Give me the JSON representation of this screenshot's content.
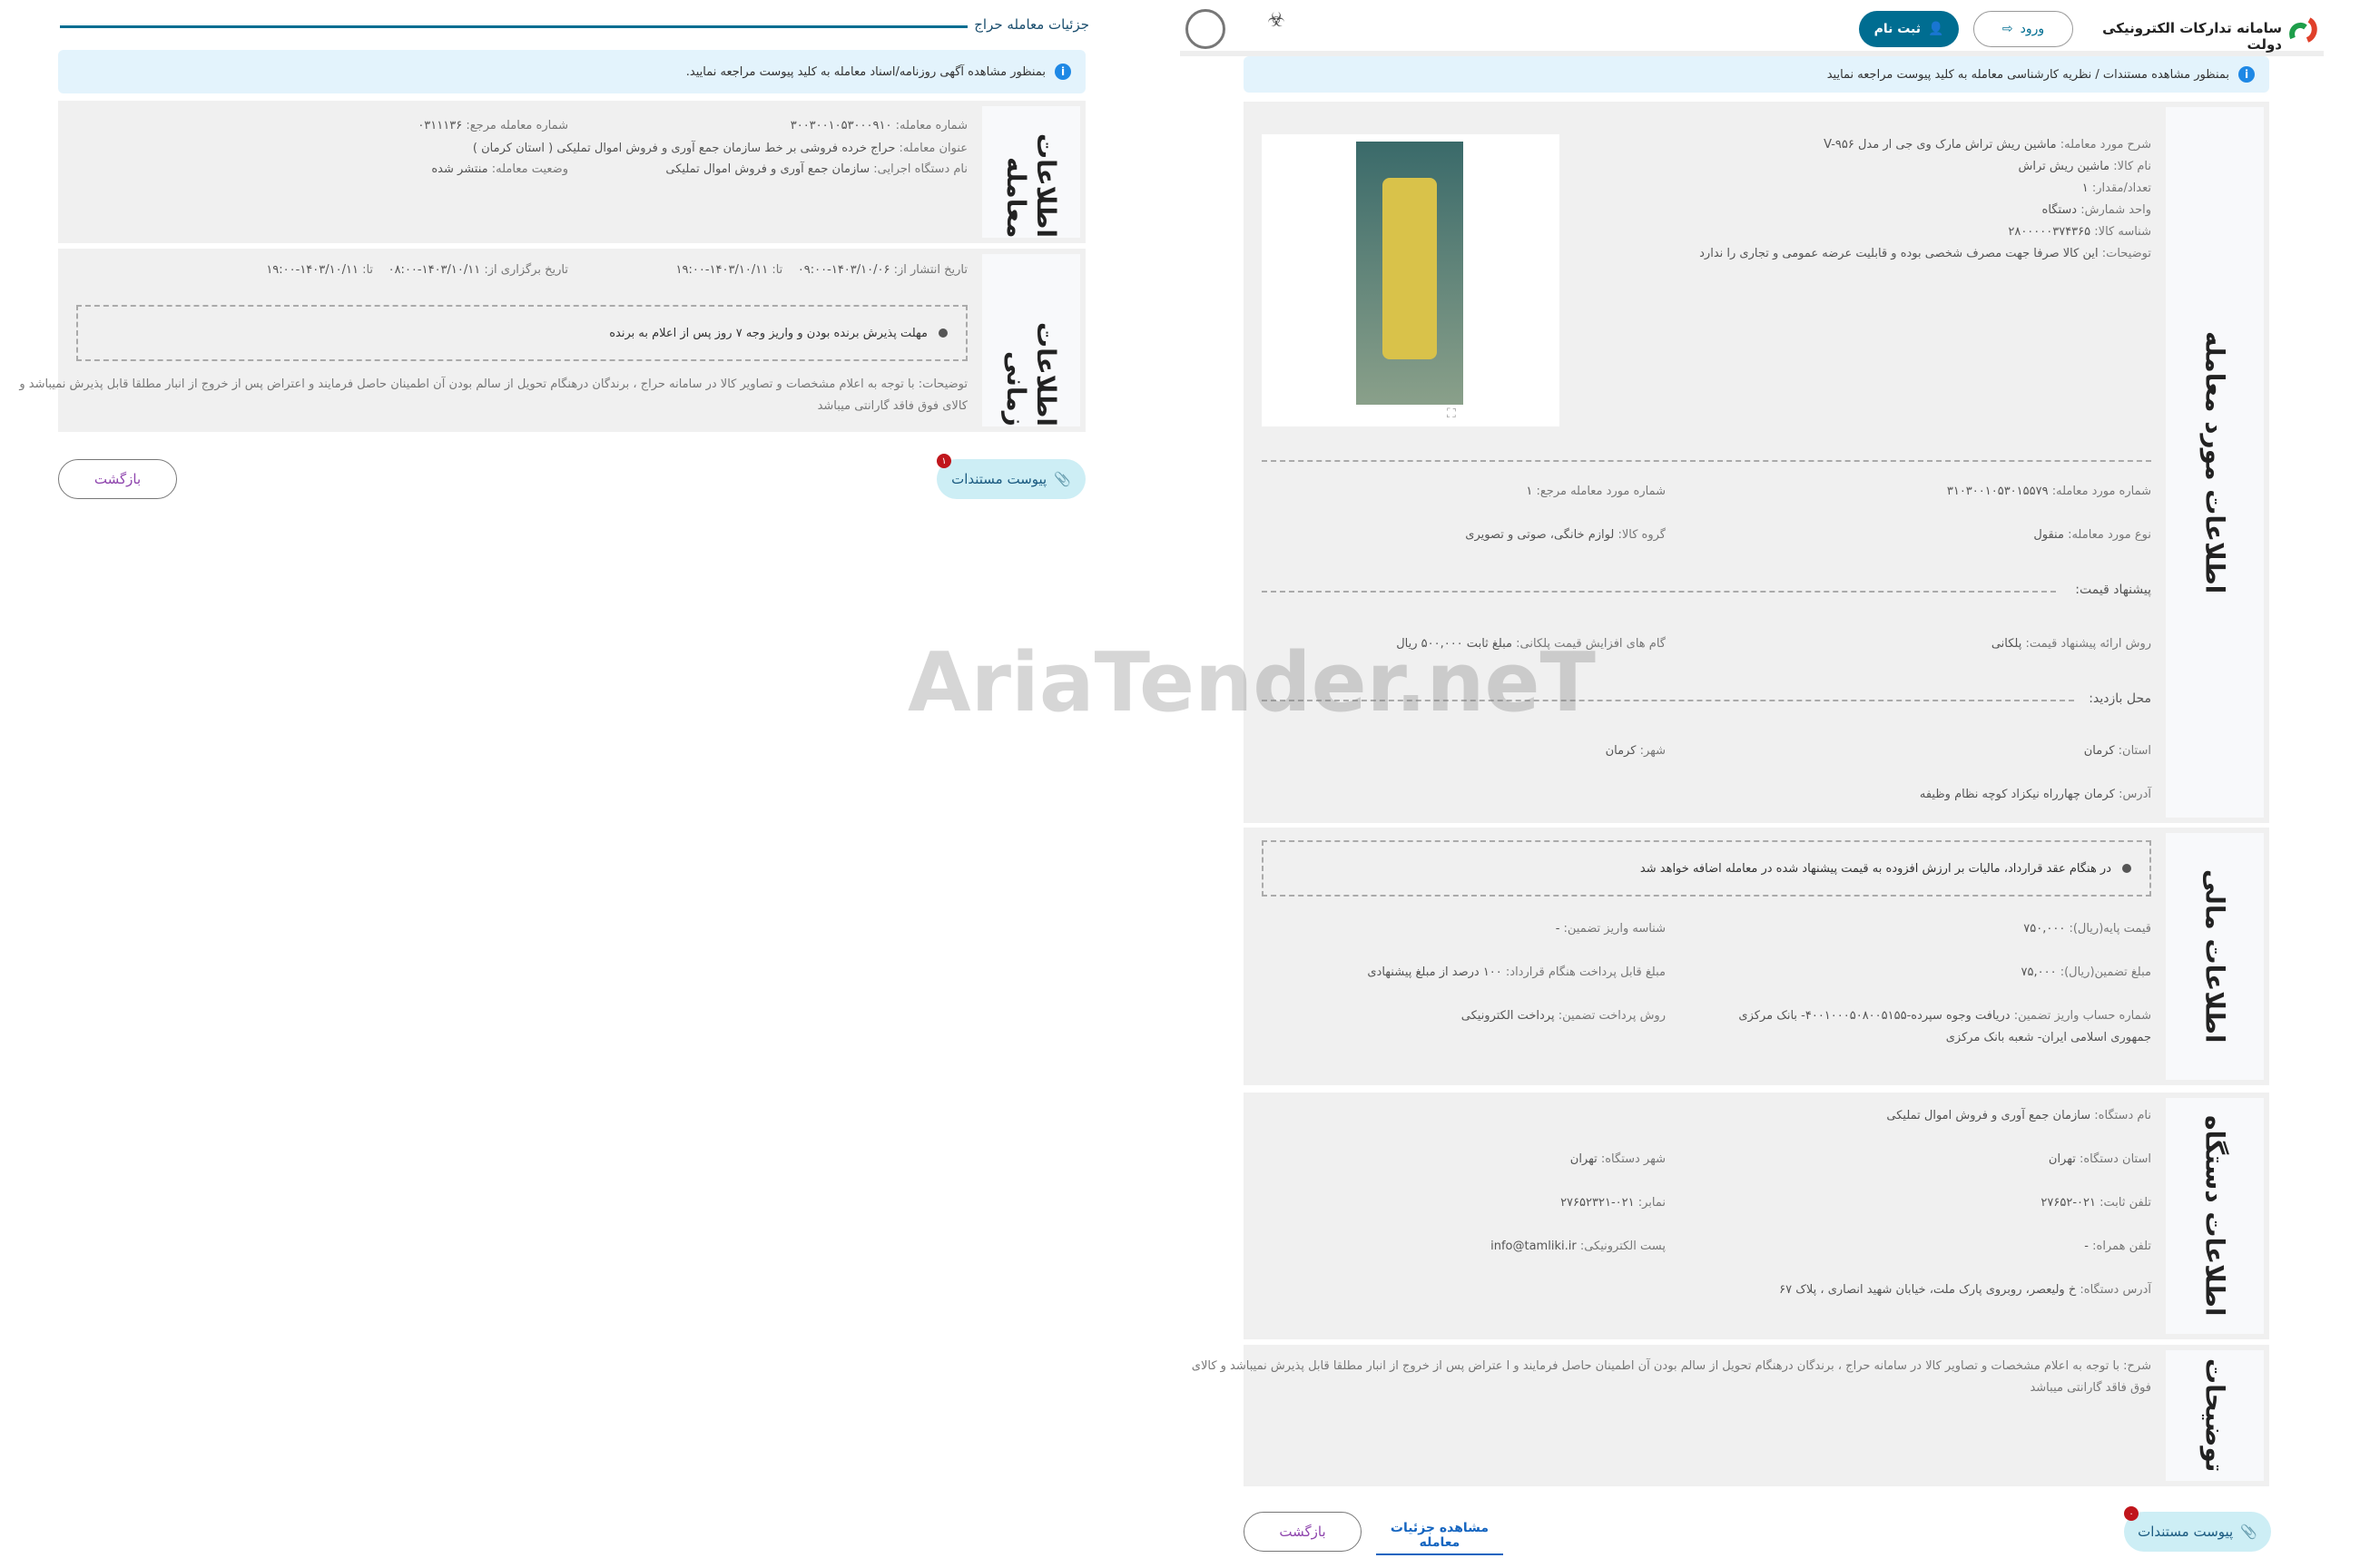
{
  "left": {
    "title": "جزئیات معامله حراج",
    "banner": "بمنظور مشاهده آگهی روزنامه/اسناد معامله به کلید پیوست مراجعه نمایید.",
    "deal_section": {
      "label": "اطلاعات معامله",
      "fields": [
        {
          "k": "شماره معامله:",
          "v": "۳۰۰۳۰۰۱۰۵۳۰۰۰۹۱۰"
        },
        {
          "k": "شماره معامله مرجع:",
          "v": "۰۳۱۱۱۳۶"
        },
        {
          "k": "عنوان معامله:",
          "v": "حراج خرده فروشی بر خط سازمان جمع آوری و فروش اموال تملیکی ( استان کرمان )"
        },
        {
          "k": "نام دستگاه اجرایی:",
          "v": "سازمان جمع آوری و فروش اموال تملیکی"
        },
        {
          "k": "وضعیت معامله:",
          "v": "منتشر شده"
        }
      ]
    },
    "time_section": {
      "label": "اطلاعات زمانی",
      "publish_from_label": "تاریخ انتشار از:",
      "publish_from": "۱۴۰۳/۱۰/۰۶-۰۹:۰۰",
      "publish_to_label": "تا:",
      "publish_to": "۱۴۰۳/۱۰/۱۱-۱۹:۰۰",
      "hold_from_label": "تاریخ برگزاری از:",
      "hold_from": "۱۴۰۳/۱۰/۱۱-۰۸:۰۰",
      "hold_to_label": "تا:",
      "hold_to": "۱۴۰۳/۱۰/۱۱-۱۹:۰۰",
      "notice": "مهلت پذیرش برنده بودن و واریز وجه ۷ روز پس از اعلام به برنده",
      "desc_line1": "توضیحات: با توجه به اعلام مشخصات و تصاویر کالا در سامانه حراج ، برندگان درهنگام تحویل از سالم بودن آن اطمینان حاصل فرمایند و اعتراض پس از خروج از انبار مطلقا قابل پذیرش نمیباشد و",
      "desc_line2": "کالای فوق فاقد گارانتی میباشد"
    },
    "attach_label": "پیوست مستندات",
    "attach_count": "۱",
    "back_label": "بازگشت"
  },
  "header": {
    "site_title": "سامانه تدارکات الکترونیکی دولت",
    "login": "ورود",
    "register": "ثبت نام",
    "accent": "#006d91"
  },
  "right": {
    "banner": "بمنظور مشاهده مستندات / نظریه کارشناسی معامله به کلید پیوست مراجعه نمایید",
    "item_section": {
      "label": "اطلاعات مورد معامله",
      "details": [
        {
          "k": "شرح مورد معامله:",
          "v": "ماشین ریش تراش مارک وی جی ار مدل V-۹۵۶"
        },
        {
          "k": "نام کالا:",
          "v": "ماشین ریش تراش"
        },
        {
          "k": "تعداد/مقدار:",
          "v": "۱"
        },
        {
          "k": "واحد شمارش:",
          "v": "دستگاه"
        },
        {
          "k": "شناسه کالا:",
          "v": "۲۸۰۰۰۰۰۳۷۴۳۶۵"
        },
        {
          "k": "توضیحات:",
          "v": "این کالا صرفا جهت مصرف شخصی بوده و قابلیت عرضه عمومی و تجاری را ندارد"
        }
      ],
      "item_no": {
        "k": "شماره مورد معامله:",
        "v": "۳۱۰۳۰۰۱۰۵۳۰۱۵۵۷۹"
      },
      "ref_no": {
        "k": "شماره مورد معامله مرجع:",
        "v": "۱"
      },
      "type": {
        "k": "نوع مورد معامله:",
        "v": "منقول"
      },
      "group": {
        "k": "گروه کالا:",
        "v": "لوازم خانگی، صوتی و تصویری"
      },
      "price_heading": "پیشنهاد قیمت:",
      "method": {
        "k": "روش ارائه پیشنهاد قیمت:",
        "v": "پلکانی"
      },
      "steps": {
        "k": "گام های افزایش قیمت پلکانی:",
        "v": "مبلغ ثابت ۵۰۰,۰۰۰ ریال"
      },
      "visit_heading": "محل بازدید:",
      "province": {
        "k": "استان:",
        "v": "کرمان"
      },
      "city": {
        "k": "شهر:",
        "v": "کرمان"
      },
      "address": {
        "k": "آدرس:",
        "v": "کرمان چهارراه نیکزاد کوچه نظام وظیفه"
      }
    },
    "finance_section": {
      "label": "اطلاعات مالی",
      "notice": "در هنگام عقد قرارداد، مالیات بر ارزش افزوده به قیمت پیشنهاد شده در معامله اضافه خواهد شد",
      "base": {
        "k": "قیمت پایه(ریال):",
        "v": "۷۵۰,۰۰۰"
      },
      "deposit_id": {
        "k": "شناسه واریز تضمین:",
        "v": "-"
      },
      "guarantee": {
        "k": "مبلغ تضمین(ریال):",
        "v": "۷۵,۰۰۰"
      },
      "payable": {
        "k": "مبلغ قابل پرداخت هنگام قرارداد:",
        "v": "۱۰۰ درصد از مبلغ پیشنهادی"
      },
      "account": {
        "k": "شماره حساب واریز تضمین:",
        "v": "دریافت وجوه سپرده-۴۰۰۱۰۰۰۵۰۸۰۰۵۱۵۵- بانک مرکزی",
        "v2": "جمهوری اسلامی ایران- شعبه بانک مرکزی"
      },
      "pay_method": {
        "k": "روش پرداخت تضمین:",
        "v": "پرداخت الکترونیکی"
      }
    },
    "org_section": {
      "label": "اطلاعات دستگاه",
      "name": {
        "k": "نام دستگاه:",
        "v": "سازمان جمع آوری و فروش اموال تملیکی"
      },
      "province": {
        "k": "استان دستگاه:",
        "v": "تهران"
      },
      "city": {
        "k": "شهر دستگاه:",
        "v": "تهران"
      },
      "phone": {
        "k": "تلفن ثابت:",
        "v": "۰۲۱-۲۷۶۵۲"
      },
      "fax": {
        "k": "نمابر:",
        "v": "۰۲۱-۲۷۶۵۲۳۲۱"
      },
      "mobile": {
        "k": "تلفن همراه:",
        "v": "-"
      },
      "email": {
        "k": "پست الکترونیکی:",
        "v": "info@tamliki.ir"
      },
      "address": {
        "k": "آدرس دستگاه:",
        "v": "خ ولیعصر، روبروی پارک ملت، خیابان شهید انصاری ، پلاک ۶۷"
      }
    },
    "desc_section": {
      "label": "توضیحات",
      "line1": "شرح: با توجه به اعلام مشخصات و تصاویر کالا در سامانه حراج ، برندگان درهنگام تحویل از سالم بودن آن اطمینان حاصل فرمایند و ا عتراض پس از خروج از انبار مطلقا قابل پذیرش نمیباشد و کالای",
      "line2": "فوق فاقد گارانتی میباشد"
    },
    "attach_label": "پیوست مستندات",
    "attach_count": "۰",
    "view_details": "مشاهده جزئیات معامله",
    "back_label": "بازگشت"
  },
  "watermark": "AriaTender.neT"
}
